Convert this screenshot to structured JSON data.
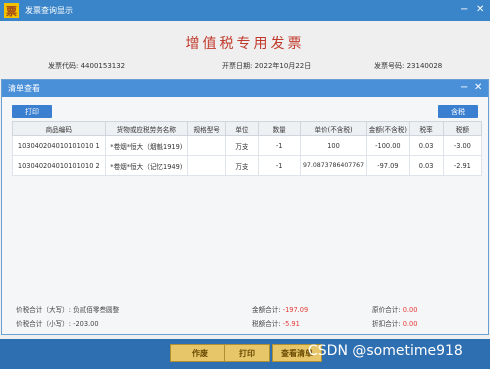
{
  "window": {
    "logo_char": "票",
    "title": "发票查询显示",
    "minimize": "−",
    "close": "✕"
  },
  "invoice": {
    "title": "增值税专用发票",
    "code_label": "发票代码:",
    "code": "4400153132",
    "date_label": "开票日期:",
    "date": "2022年10月22日",
    "number_label": "发票号码:",
    "number": "23140028"
  },
  "dialog": {
    "title": "清单查看",
    "minimize": "−",
    "close": "✕",
    "print_button": "打印",
    "tax_button": "含税"
  },
  "table": {
    "headers": [
      "商品编码",
      "货物或应税劳务名称",
      "规格型号",
      "单位",
      "数量",
      "单价(不含税)",
      "金额(不含税)",
      "税率",
      "税额"
    ],
    "rows": [
      [
        "103040204010101010 1",
        "*卷烟*恒大（烟魁1919)",
        "",
        "万支",
        "-1",
        "100",
        "-100.00",
        "0.03",
        "-3.00"
      ],
      [
        "103040204010101010 2",
        "*卷烟*恒大（记忆1949)",
        "",
        "万支",
        "-1",
        "97.0873786407767",
        "-97.09",
        "0.03",
        "-2.91"
      ]
    ]
  },
  "summary": {
    "total_upper_label": "价税合计（大写）:",
    "total_upper": "负贰佰零叁圆整",
    "total_lower_label": "价税合计（小写）:",
    "total_lower": "-203.00",
    "amount_label": "金额合计:",
    "amount": "-197.09",
    "tax_label": "税额合计:",
    "tax": "-5.91",
    "original_price_label": "原价合计:",
    "original_price": "0.00",
    "discount_label": "折扣合计:",
    "discount": "0.00"
  },
  "bottom": {
    "void_button": "作废",
    "print_button": "打印",
    "view_list_button": "查看清单",
    "watermark": "CSDN @sometime918"
  },
  "colors": {
    "titlebar": "#3a85c9",
    "dialog_titlebar": "#4a90d9",
    "invoice_title": "#c0392b",
    "negative": "#e53935",
    "bottom_bar": "#2e6fb2",
    "bottom_button": "#e7c66a"
  }
}
